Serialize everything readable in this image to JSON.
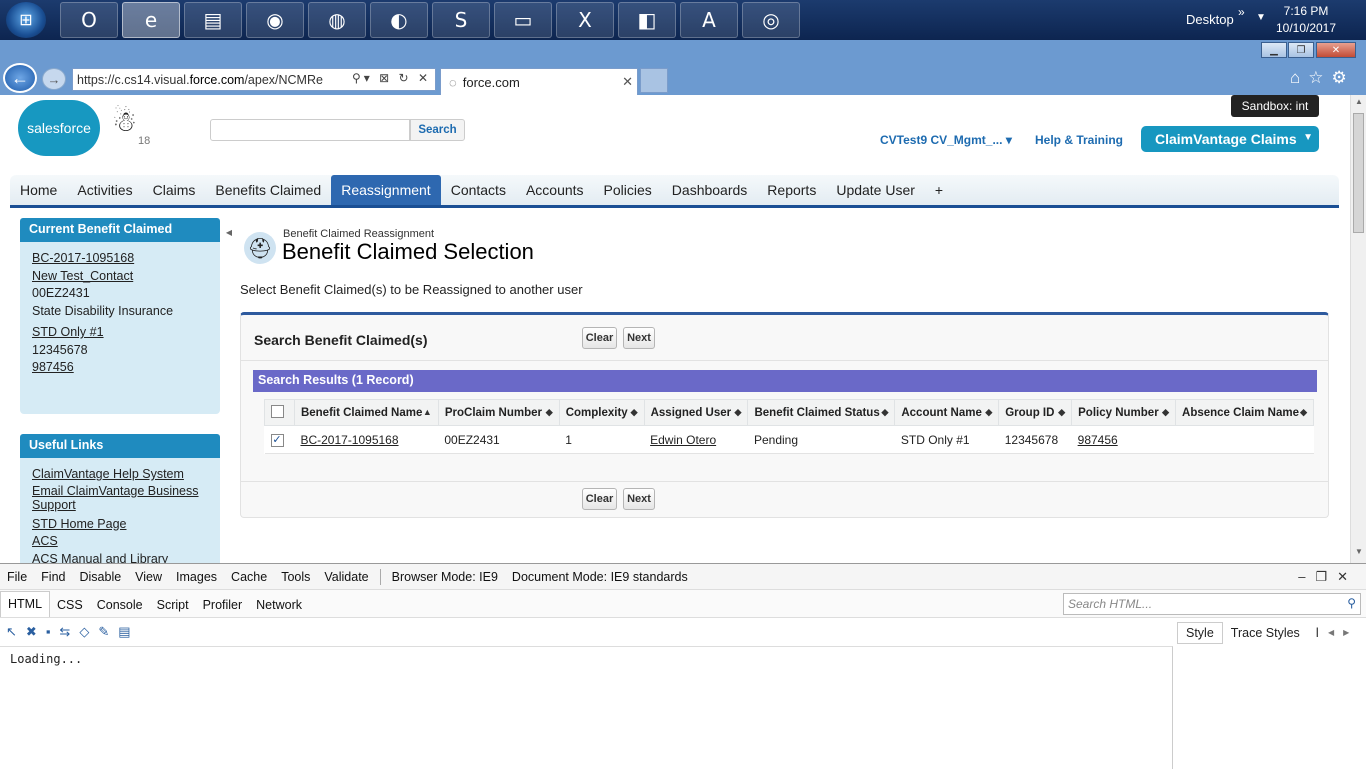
{
  "taskbar": {
    "start_icon": "windows-orb",
    "apps": [
      {
        "name": "outlook-icon",
        "glyph": "O"
      },
      {
        "name": "internet-explorer-icon",
        "glyph": "e"
      },
      {
        "name": "file-explorer-icon",
        "glyph": "▤"
      },
      {
        "name": "chrome-icon",
        "glyph": "◉"
      },
      {
        "name": "firefox-icon",
        "glyph": "◍"
      },
      {
        "name": "eclipse-icon",
        "glyph": "◐"
      },
      {
        "name": "skype-icon",
        "glyph": "S"
      },
      {
        "name": "sticky-notes-icon",
        "glyph": "▭"
      },
      {
        "name": "excel-icon",
        "glyph": "X"
      },
      {
        "name": "notepad-icon",
        "glyph": "◧"
      },
      {
        "name": "access-icon",
        "glyph": "A"
      },
      {
        "name": "app-icon",
        "glyph": "◎"
      }
    ],
    "desktop_label": "Desktop",
    "time": "7:16 PM",
    "date": "10/10/2017"
  },
  "browser": {
    "url_prefix": "https://c.cs14.visual.",
    "url_host": "force.com",
    "url_suffix": "/apex/NCMRe",
    "tab_title": "force.com"
  },
  "header": {
    "logo_text": "salesforce",
    "mascot_count": "18",
    "search_placeholder": "",
    "search_button": "Search",
    "sandbox": "Sandbox:  int",
    "user_menu": "CVTest9 CV_Mgmt_...",
    "help": "Help & Training",
    "app_menu": "ClaimVantage Claims"
  },
  "tabs": [
    {
      "label": "Home",
      "active": false
    },
    {
      "label": "Activities",
      "active": false
    },
    {
      "label": "Claims",
      "active": false
    },
    {
      "label": "Benefits Claimed",
      "active": false
    },
    {
      "label": "Reassignment",
      "active": true
    },
    {
      "label": "Contacts",
      "active": false
    },
    {
      "label": "Accounts",
      "active": false
    },
    {
      "label": "Policies",
      "active": false
    },
    {
      "label": "Dashboards",
      "active": false
    },
    {
      "label": "Reports",
      "active": false
    },
    {
      "label": "Update User",
      "active": false
    },
    {
      "label": "+",
      "active": false
    }
  ],
  "sidebar": {
    "current": {
      "title": "Current Benefit Claimed",
      "lines": [
        {
          "text": "BC-2017-1095168",
          "link": true
        },
        {
          "text": "New Test_Contact",
          "link": true
        },
        {
          "text": "00EZ2431",
          "link": false
        },
        {
          "text": "State Disability Insurance",
          "link": false
        },
        {
          "text": "STD Only #1",
          "link": true
        },
        {
          "text": "12345678",
          "link": false
        },
        {
          "text": "987456",
          "link": true
        }
      ]
    },
    "useful": {
      "title": "Useful Links",
      "lines": [
        {
          "text": "ClaimVantage Help System",
          "link": true
        },
        {
          "text": "Email ClaimVantage Business Support",
          "link": true
        },
        {
          "text": "STD Home Page",
          "link": true
        },
        {
          "text": "ACS",
          "link": true
        },
        {
          "text": "ACS Manual and Library",
          "link": true
        }
      ]
    }
  },
  "main": {
    "subtitle": "Benefit Claimed Reassignment",
    "title": "Benefit Claimed Selection",
    "description": "Select Benefit Claimed(s) to be Reassigned to another user",
    "panel_title": "Search Benefit Claimed(s)",
    "clear_label": "Clear",
    "next_label": "Next",
    "results_title": "Search Results (1 Record)",
    "columns": [
      "Benefit Claimed Name",
      "ProClaim Number",
      "Complexity",
      "Assigned User",
      "Benefit Claimed Status",
      "Account Name",
      "Group ID",
      "Policy Number",
      "Absence Claim Name"
    ],
    "rows": [
      {
        "checked": true,
        "cells": [
          "BC-2017-1095168",
          "00EZ2431",
          "1",
          "Edwin Otero",
          "Pending",
          "STD Only #1",
          "12345678",
          "987456",
          ""
        ]
      }
    ]
  },
  "devtools": {
    "menu": [
      "File",
      "Find",
      "Disable",
      "View",
      "Images",
      "Cache",
      "Tools",
      "Validate"
    ],
    "browser_mode": "Browser Mode: IE9",
    "document_mode": "Document Mode: IE9 standards",
    "tabs": [
      "HTML",
      "CSS",
      "Console",
      "Script",
      "Profiler",
      "Network"
    ],
    "search_placeholder": "Search HTML...",
    "loading": "Loading...",
    "side_tabs": [
      "Style",
      "Trace Styles",
      "l"
    ]
  }
}
